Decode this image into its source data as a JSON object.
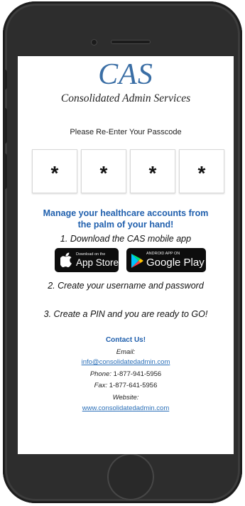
{
  "brand": {
    "logo": "CAS",
    "name": "Consolidated Admin Services"
  },
  "login": {
    "prompt": "Please Re-Enter Your Passcode",
    "pin_digits": [
      "*",
      "*",
      "*",
      "*"
    ]
  },
  "promo": {
    "headline_line1": "Manage your healthcare accounts from",
    "headline_line2": "the palm of your hand!",
    "step1": "1. Download the CAS mobile app",
    "step2": "2. Create your username and password",
    "step3": "3. Create a PIN and you are ready to GO!"
  },
  "stores": {
    "app_store_small": "Download on the",
    "app_store_big": "App Store",
    "google_play_small": "ANDROID APP ON",
    "google_play_big": "Google Play"
  },
  "contact": {
    "title": "Contact Us!",
    "email_label": "Email:",
    "email": "info@consolidatedadmin.com",
    "phone_label": "Phone:",
    "phone": "1-877-941-5956",
    "fax_label": "Fax:",
    "fax": "1-877-641-5956",
    "website_label": "Website:",
    "website": "www.consolidatedadmin.com"
  },
  "icons": {
    "apple": "apple-icon",
    "google_play": "google-play-icon"
  },
  "colors": {
    "accent": "#1f5fad",
    "logo": "#3a6ea5",
    "link": "#2a6fb8",
    "device": "#2d2d2d"
  }
}
